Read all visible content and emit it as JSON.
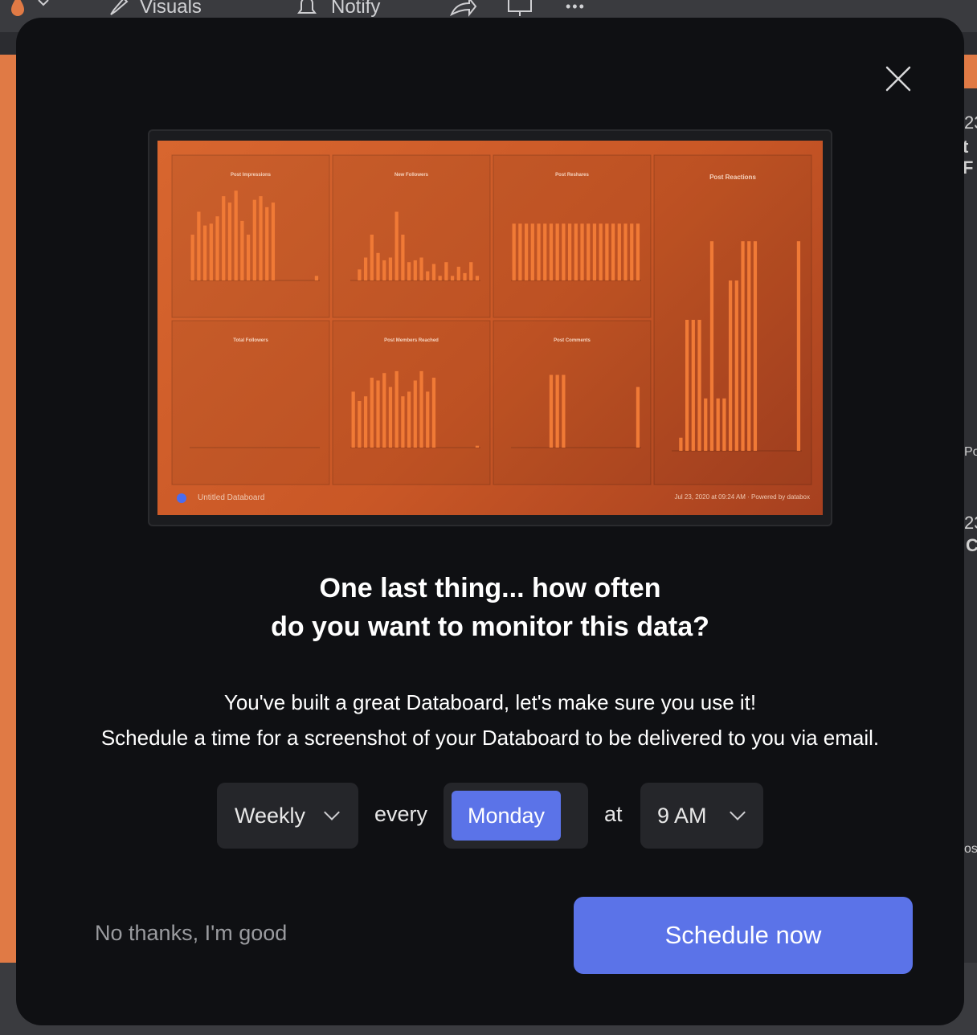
{
  "toolbar": {
    "visuals_label": "Visuals",
    "notify_label": "Notify",
    "more_label": "•••"
  },
  "background_fragments": [
    "23",
    "t F",
    "Po",
    "23",
    "C",
    "os"
  ],
  "modal": {
    "preview": {
      "footer_title": "Untitled Databoard",
      "footer_right": "Jul 23, 2020 at 09:24 AM · Powered by databox",
      "panels": [
        {
          "title": "Post Impressions"
        },
        {
          "title": "New Followers"
        },
        {
          "title": "Post Reshares"
        },
        {
          "title": "Post Reactions"
        },
        {
          "title": "Total Followers"
        },
        {
          "title": "Post Members Reached"
        },
        {
          "title": "Post Comments"
        }
      ]
    },
    "headline_line1": "One last thing... how often",
    "headline_line2": "do you want to monitor this data?",
    "sub_line1": "You've built a great Databoard, let's make sure you use it!",
    "sub_line2": "Schedule a time for a screenshot of your Databoard to be delivered to you via email.",
    "frequency": "Weekly",
    "every_label": "every",
    "day": "Monday",
    "at_label": "at",
    "time": "9 AM",
    "no_thanks": "No thanks, I'm good",
    "schedule_button": "Schedule now"
  },
  "colors": {
    "accent": "#5b73e8",
    "modal_bg": "#0f1013",
    "preview_orange": "#d8662f"
  }
}
